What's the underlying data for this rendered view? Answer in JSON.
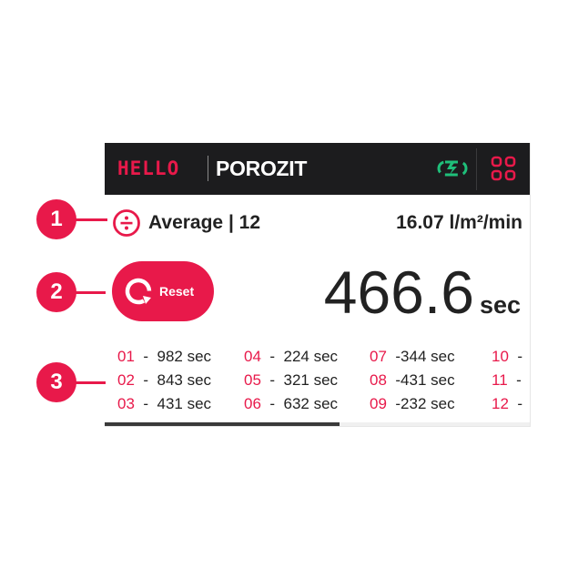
{
  "header": {
    "logo_brand": "HELLO",
    "logo_product": "POROZIT",
    "link_icon": "sync-link-icon",
    "menu_icon": "grid-menu-icon"
  },
  "summary": {
    "mode_icon": "divide-circle-icon",
    "mode_label": "Average | 12",
    "flow_rate": "16.07 l/m²/min"
  },
  "reset": {
    "icon": "reset-arrow-icon",
    "label": "Reset"
  },
  "result": {
    "value": "466.6",
    "unit": "sec"
  },
  "measurements": [
    {
      "num": "01",
      "sep": "-",
      "value": "982 sec"
    },
    {
      "num": "02",
      "sep": "-",
      "value": "843 sec"
    },
    {
      "num": "03",
      "sep": "-",
      "value": "431 sec"
    },
    {
      "num": "04",
      "sep": "-",
      "value": "224 sec"
    },
    {
      "num": "05",
      "sep": "-",
      "value": "321 sec"
    },
    {
      "num": "06",
      "sep": "-",
      "value": "632 sec"
    },
    {
      "num": "07",
      "sep": "-",
      "value": "344 sec"
    },
    {
      "num": "08",
      "sep": "-",
      "value": "431 sec"
    },
    {
      "num": "09",
      "sep": "-",
      "value": "232 sec"
    },
    {
      "num": "10",
      "sep": "-",
      "value": ""
    },
    {
      "num": "11",
      "sep": "-",
      "value": ""
    },
    {
      "num": "12",
      "sep": "-",
      "value": ""
    }
  ],
  "callouts": [
    "1",
    "2",
    "3"
  ],
  "colors": {
    "accent": "#e8194a",
    "header_bg": "#1c1c1e",
    "link_icon": "#1fbf7a"
  }
}
